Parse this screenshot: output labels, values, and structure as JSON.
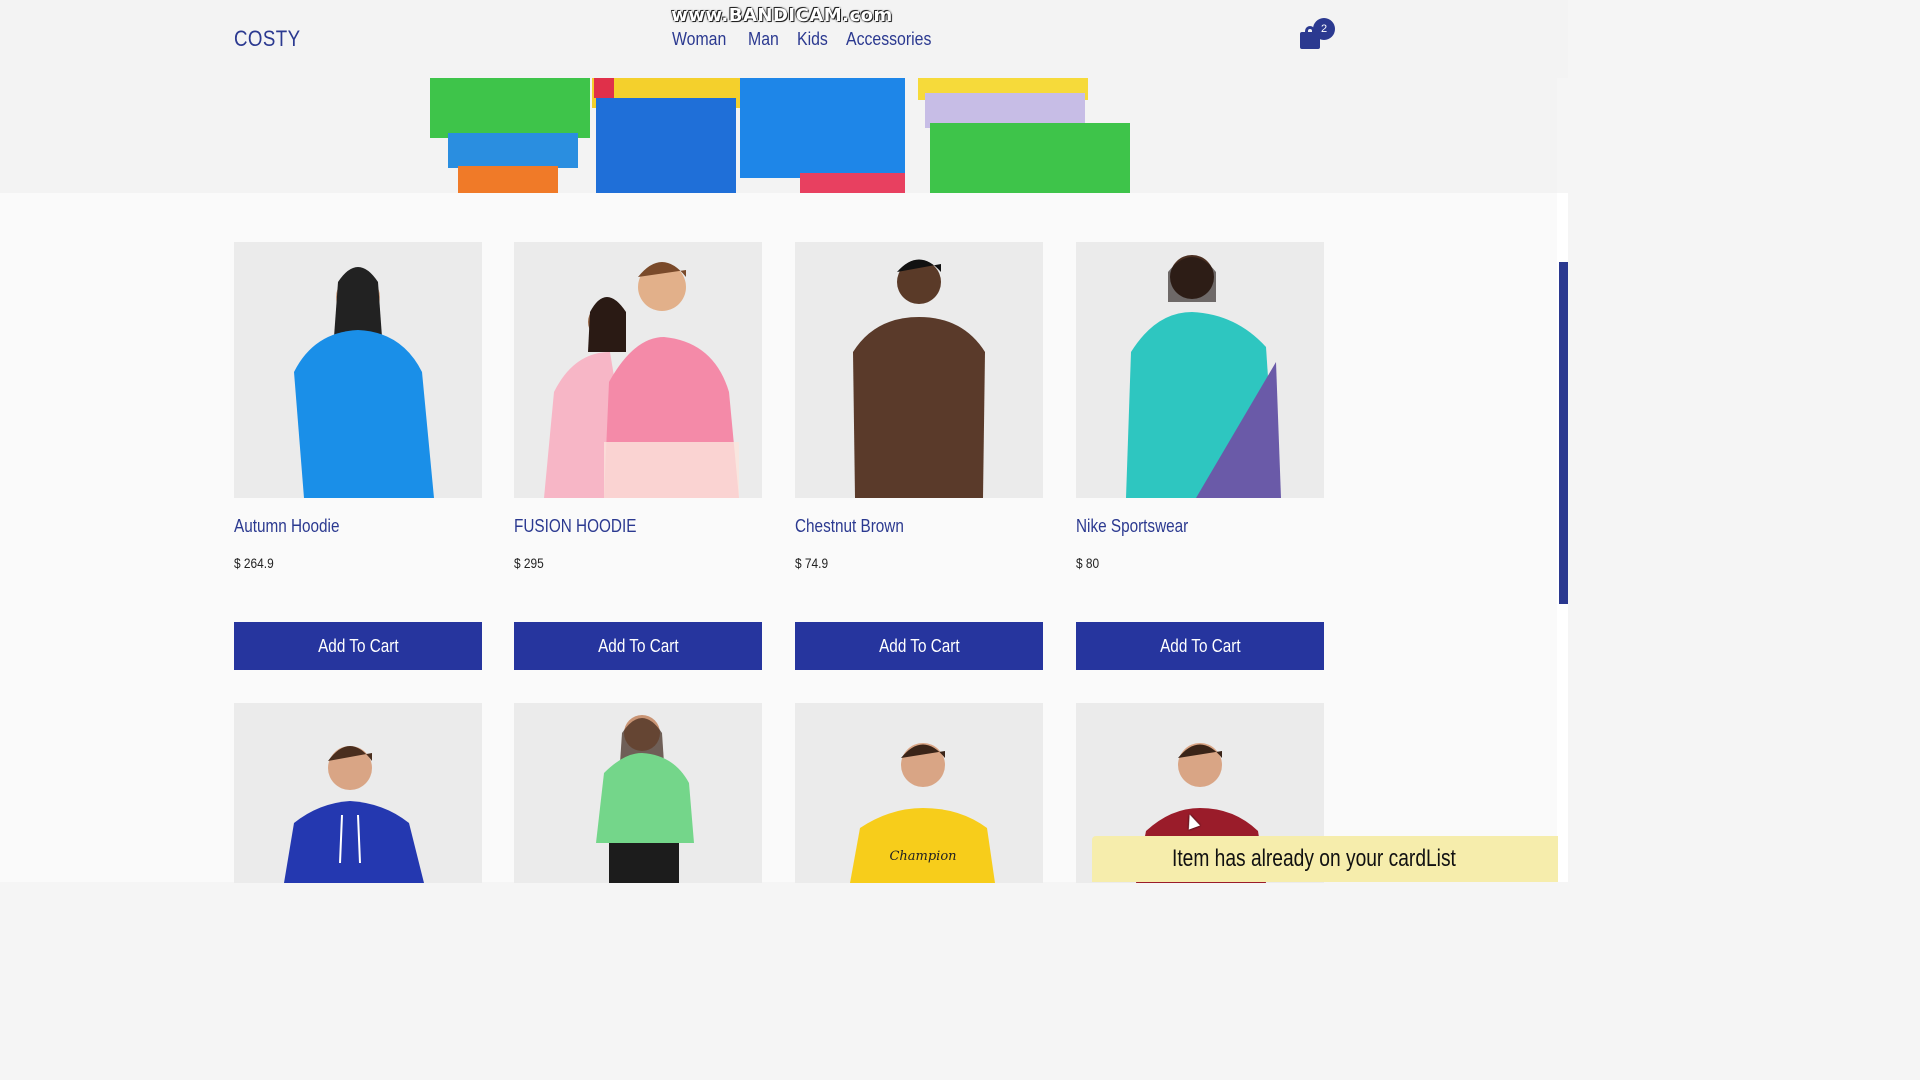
{
  "watermark": "www.BANDICAM.com",
  "header": {
    "logo": "COSTY",
    "nav": [
      "Woman",
      "Man",
      "Kids",
      "Accessories"
    ],
    "cart_count": "2"
  },
  "products": [
    {
      "name": "Autumn Hoodie",
      "price": "$ 264.9",
      "button": "Add To Cart",
      "color": "#1a8fe8"
    },
    {
      "name": "FUSION HOODIE",
      "price": "$ 295",
      "button": "Add To Cart",
      "color": "#f48aa8"
    },
    {
      "name": "Chestnut Brown",
      "price": "$ 74.9",
      "button": "Add To Cart",
      "color": "#5a3a2a"
    },
    {
      "name": "Nike Sportswear",
      "price": "$ 80",
      "button": "Add To Cart",
      "color": "#2ec6c0"
    }
  ],
  "products_row2": [
    {
      "color": "#2438b0"
    },
    {
      "color": "#74d68a"
    },
    {
      "color": "#f7cd1b",
      "print": "Champion"
    },
    {
      "color": "#9a1c2a"
    }
  ],
  "toast": "Item has already on your cardList",
  "colors": {
    "brand": "#2b3990",
    "button": "#26359e",
    "toast_bg": "#f6edac"
  }
}
